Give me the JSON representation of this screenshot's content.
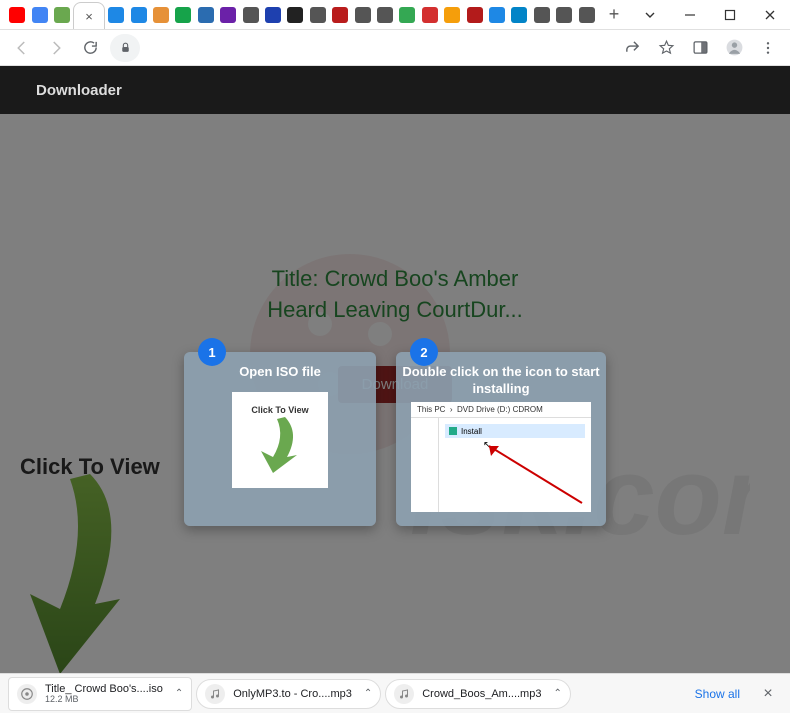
{
  "window": {
    "tabs_icons": [
      {
        "name": "youtube-icon",
        "color": "#ff0000"
      },
      {
        "name": "google-icon",
        "color": "#4285f4"
      },
      {
        "name": "translate-icon",
        "color": "#6aa84f"
      },
      {
        "name": "active-tab",
        "color": "#ffffff"
      },
      {
        "name": "cloud-down-icon",
        "color": "#1e88e5"
      },
      {
        "name": "cloud-down-icon",
        "color": "#1e88e5"
      },
      {
        "name": "camel-icon",
        "color": "#e69138"
      },
      {
        "name": "plus-green-icon",
        "color": "#16a34a"
      },
      {
        "name": "grid-blue-icon",
        "color": "#2b6cb0"
      },
      {
        "name": "circle-purple-icon",
        "color": "#6b21a8"
      },
      {
        "name": "globe-icon",
        "color": "#555555"
      },
      {
        "name": "video-icon",
        "color": "#1e40af"
      },
      {
        "name": "circle-dark-icon",
        "color": "#222222"
      },
      {
        "name": "globe-icon",
        "color": "#555555"
      },
      {
        "name": "download-red-icon",
        "color": "#b91c1c"
      },
      {
        "name": "hook-icon",
        "color": "#555555"
      },
      {
        "name": "globe-icon",
        "color": "#555555"
      },
      {
        "name": "sheets-icon",
        "color": "#34a853"
      },
      {
        "name": "adblock-icon",
        "color": "#d32f2f"
      },
      {
        "name": "download-yellow-icon",
        "color": "#f59e0b"
      },
      {
        "name": "ym-icon",
        "color": "#b31b1b"
      },
      {
        "name": "cloud-arrow-icon",
        "color": "#1e88e5"
      },
      {
        "name": "bitly-icon",
        "color": "#0284c7"
      },
      {
        "name": "globe-icon",
        "color": "#555555"
      },
      {
        "name": "globe-icon",
        "color": "#555555"
      },
      {
        "name": "gear-icon",
        "color": "#555555"
      }
    ]
  },
  "header": {
    "app_name": "Downloader"
  },
  "page": {
    "title_text": "Title: Crowd Boo's Amber Heard Leaving CourtDur...",
    "download_label": "Download",
    "click_to_view": "Click To View"
  },
  "cards": [
    {
      "step": "1",
      "heading": "Open ISO file",
      "thumb_label": "Click To View"
    },
    {
      "step": "2",
      "heading": "Double click on the icon to start installing",
      "explorer_path_a": "This PC",
      "explorer_path_b": "DVD Drive (D:) CDROM",
      "install_label": "Install"
    }
  ],
  "downloads": {
    "items": [
      {
        "name": "Title_ Crowd Boo's....iso",
        "meta": "12.2 MB"
      },
      {
        "name": "OnlyMP3.to - Cro....mp3",
        "meta": ""
      },
      {
        "name": "Crowd_Boos_Am....mp3",
        "meta": ""
      }
    ],
    "show_all": "Show all"
  }
}
